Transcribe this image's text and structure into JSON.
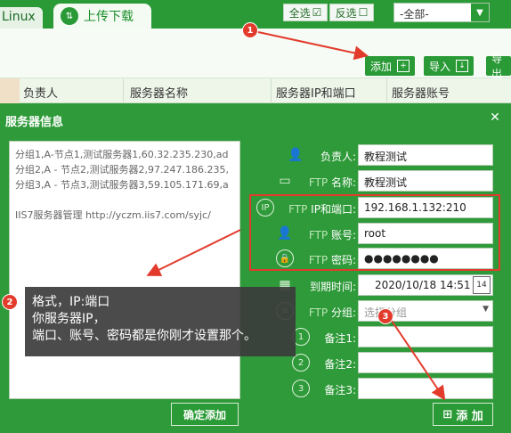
{
  "top": {
    "tab_linux": "Linux",
    "tab_upload": "上传下载",
    "select_all": "全选",
    "invert_select": "反选",
    "filter_value": "-全部-"
  },
  "toolbar": {
    "add": "添加",
    "import": "导入",
    "export": "导出"
  },
  "columns": [
    "负责人",
    "服务器名称",
    "服务器IP和端口",
    "服务器账号"
  ],
  "modal": {
    "title": "服务器信息",
    "text_lines": [
      "分组1,A-节点1,测试服务器1,60.32.235.230,ad",
      "分组2,A - 节点2,测试服务器2,97.247.186.235,",
      "分组3,A - 节点3,测试服务器3,59.105.171.69,a",
      "",
      "IIS7服务器管理 http://yczm.iis7.com/syjc/"
    ],
    "confirm_add": "确定添加",
    "add_button": "添 加",
    "fields": {
      "owner_label": "负责人:",
      "owner_value": "教程测试",
      "name_label_ftp": "FTP",
      "name_label": "名称:",
      "name_value": "教程测试",
      "ip_label_ftp": "FTP",
      "ip_label": "IP和端口:",
      "ip_value": "192.168.1.132:210",
      "account_label_ftp": "FTP",
      "account_label": "账号:",
      "account_value": "root",
      "password_label_ftp": "FTP",
      "password_label": "密码:",
      "password_value": "●●●●●●●●",
      "expire_label": "到期时间:",
      "expire_value": "2020/10/18 14:51",
      "group_label_ftp": "FTP",
      "group_label": "分组:",
      "group_placeholder": "选择分组",
      "note1_label": "备注1:",
      "note2_label": "备注2:",
      "note3_label": "备注3:"
    }
  },
  "annotations": {
    "badge1": "1",
    "badge2": "2",
    "badge3": "3",
    "callout_lines": [
      "格式，IP:端口",
      "你服务器IP，",
      "端口、账号、密码都是你刚才设置那个。"
    ]
  },
  "colors": {
    "brand_green": "#2a9a36",
    "annotation_red": "#e23b2c"
  }
}
